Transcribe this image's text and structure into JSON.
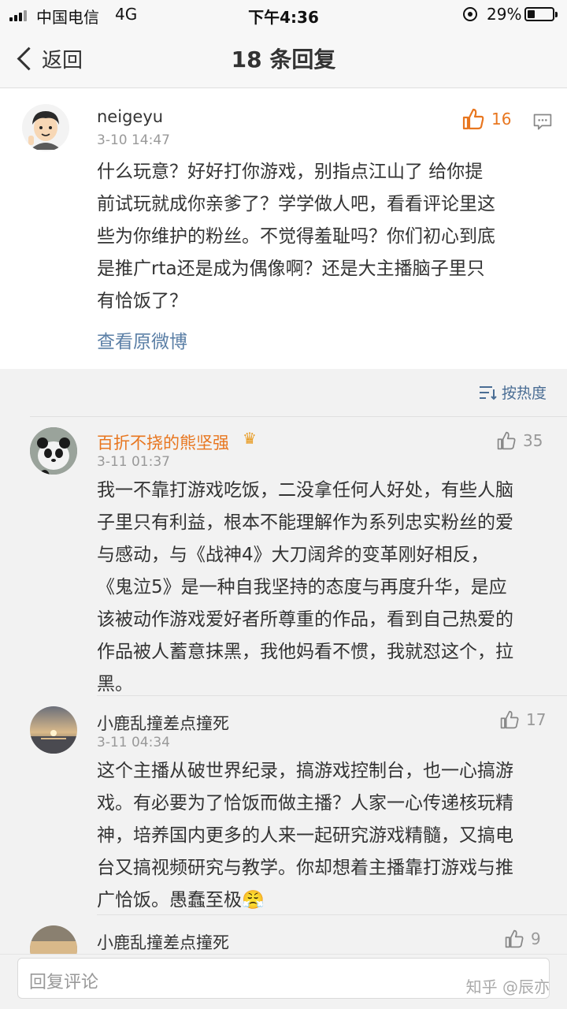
{
  "status_bar": {
    "carrier": "中国电信",
    "network": "4G",
    "time": "下午4:36",
    "battery": "29%",
    "battery_level": 0.29
  },
  "nav": {
    "back_label": "返回",
    "title": "18 条回复"
  },
  "main_comment": {
    "username": "neigeyu",
    "time": "3-10 14:47",
    "likes": "16",
    "lines": [
      "什么玩意？好好打你游戏，别指点江山了 给你提",
      "前试玩就成你亲爹了？学学做人吧，看看评论里这",
      "些为你维护的粉丝。不觉得羞耻吗？你们初心到底",
      "是推广rta还是成为偶像啊？还是大主播脑子里只",
      "有恰饭了？"
    ],
    "view_original": "查看原微博",
    "like_color": "#e8761f"
  },
  "sort_label": "按热度",
  "replies": [
    {
      "username": "百折不挠的熊坚强",
      "time": "3-11 01:37",
      "likes": "35",
      "lines": [
        "我一不靠打游戏吃饭，二没拿任何人好处，有些人脑",
        "子里只有利益，根本不能理解作为系列忠实粉丝的爱",
        "与感动，与《战神4》大刀阔斧的变革刚好相反，",
        "《鬼泣5》是一种自我坚持的态度与再度升华，是应",
        "该被动作游戏爱好者所尊重的作品，看到自己热爱的",
        "作品被人蓄意抹黑，我他妈看不惯，我就怼这个，拉",
        "黑。"
      ]
    },
    {
      "username": "小鹿乱撞差点撞死",
      "time": "3-11 04:34",
      "likes": "17",
      "lines": [
        "这个主播从破世界纪录，搞游戏控制台，也一心搞游",
        "戏。有必要为了恰饭而做主播？人家一心传递核玩精",
        "神，培养国内更多的人来一起研究游戏精髓，又搞电",
        "台又搞视频研究与教学。你却想着主播靠打游戏与推",
        "广恰饭。愚蠢至极😤"
      ]
    },
    {
      "username": "小鹿乱撞差点撞死",
      "likes": "9"
    }
  ],
  "input_placeholder": "回复评论",
  "watermark": "知乎 @辰亦"
}
